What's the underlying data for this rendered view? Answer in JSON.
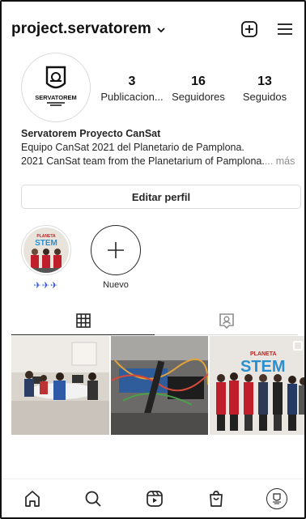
{
  "header": {
    "username": "project.servatorem",
    "icons": [
      "chevron-down-icon",
      "new-post-icon",
      "menu-icon"
    ]
  },
  "profile": {
    "logo_text": "SERVATOREM",
    "stats": [
      {
        "value": "3",
        "label": "Publicacion..."
      },
      {
        "value": "16",
        "label": "Seguidores"
      },
      {
        "value": "13",
        "label": "Seguidos"
      }
    ],
    "bio": {
      "name": "Servatorem Proyecto CanSat",
      "line1": "Equipo CanSat 2021 del Planetario de Pamplona.",
      "line2": "2021 CanSat team from the Planetarium of Pamplona.",
      "more": "... más"
    },
    "edit_button": "Editar perfil"
  },
  "highlights": [
    {
      "label": "✈✈✈",
      "type": "story"
    },
    {
      "label": "Nuevo",
      "type": "new"
    }
  ],
  "tabs": [
    {
      "icon": "grid-icon",
      "active": true
    },
    {
      "icon": "tagged-icon",
      "active": false
    }
  ],
  "posts": [
    {
      "kind": "classroom"
    },
    {
      "kind": "electronics"
    },
    {
      "kind": "team-photo",
      "banner": "PLANETA STEM"
    }
  ],
  "bottom_nav": [
    "home-icon",
    "search-icon",
    "reels-icon",
    "shop-icon",
    "profile-avatar"
  ],
  "colors": {
    "text": "#262626",
    "border": "#dbdbdb",
    "muted": "#8e8e8e",
    "link_blue": "#3b5ed1"
  }
}
